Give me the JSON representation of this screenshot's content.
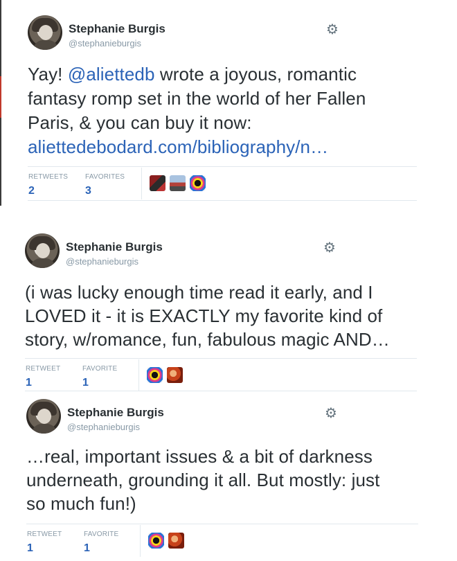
{
  "tweets": [
    {
      "author_name": "Stephanie Burgis",
      "author_handle": "@stephanieburgis",
      "text_line1_prefix": "Yay! ",
      "text_mention": "@aliettedb",
      "text_line1_suffix": " wrote a joyous, romantic",
      "text_line2": "fantasy romp set in the world of her Fallen",
      "text_line3": "Paris, & you can buy it now:",
      "text_link": "aliettedebodard.com/bibliography/n…",
      "retweets_label": "RETWEETS",
      "retweets_count": "2",
      "favorites_label": "FAVORITES",
      "favorites_count": "3",
      "favoriters": [
        "avatar-red-dark",
        "avatar-street-scene",
        "avatar-rainbow-circle"
      ]
    },
    {
      "author_name": "Stephanie Burgis",
      "author_handle": "@stephanieburgis",
      "text_line1": "(i was lucky enough time read it early, and I",
      "text_line2": "LOVED it - it is EXACTLY my favorite kind of",
      "text_line3": "story, w/romance, fun, fabulous magic AND…",
      "retweets_label": "RETWEET",
      "retweets_count": "1",
      "favorites_label": "FAVORITE",
      "favorites_count": "1",
      "favoriters": [
        "avatar-rainbow-circle",
        "avatar-orange-redhead"
      ]
    },
    {
      "author_name": "Stephanie Burgis",
      "author_handle": "@stephanieburgis",
      "text_line1": "…real, important issues & a bit of darkness",
      "text_line2": "underneath, grounding it all. But mostly: just",
      "text_line3": "so much fun!)",
      "retweets_label": "RETWEET",
      "retweets_count": "1",
      "favorites_label": "FAVORITE",
      "favorites_count": "1",
      "favoriters": [
        "avatar-rainbow-circle",
        "avatar-orange-redhead"
      ]
    }
  ],
  "colors": {
    "link": "#2b63b7",
    "text": "#292f33",
    "muted": "#8899a6",
    "border": "#e1e8ed"
  },
  "icons": {
    "gear": "gear-icon"
  }
}
